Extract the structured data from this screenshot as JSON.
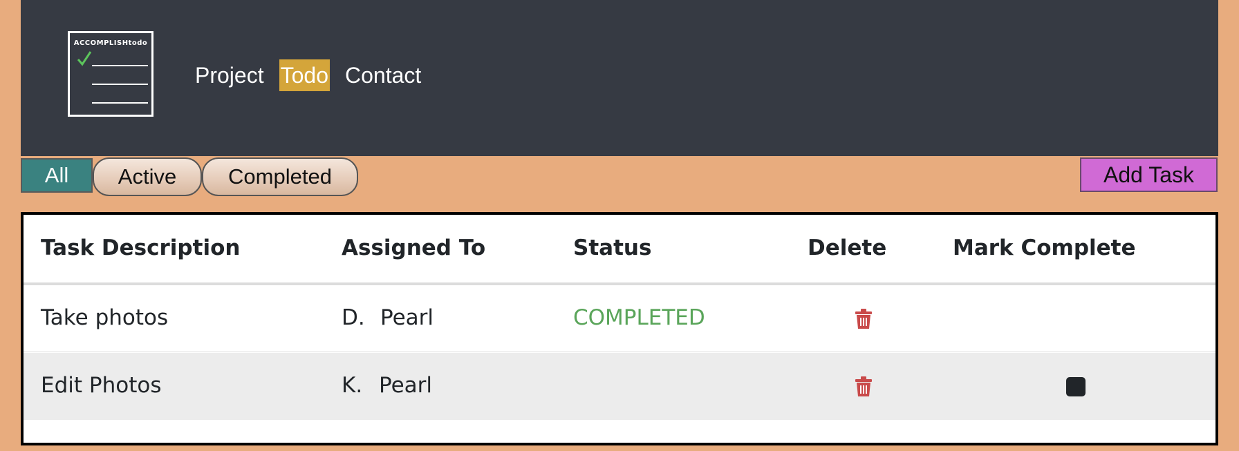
{
  "header": {
    "logo_text": "ACCOMPLISHtodo",
    "nav": [
      {
        "label": "Project",
        "active": false
      },
      {
        "label": "Todo",
        "active": true
      },
      {
        "label": "Contact",
        "active": false
      }
    ]
  },
  "filters": {
    "all": "All",
    "active": "Active",
    "completed": "Completed"
  },
  "add_task_label": "Add Task",
  "table": {
    "columns": [
      "Task Description",
      "Assigned To",
      "Status",
      "Delete",
      "Mark Complete"
    ],
    "rows": [
      {
        "description": "Take photos",
        "initial": "D.",
        "name": "Pearl",
        "status": "COMPLETED",
        "show_checkbox": false
      },
      {
        "description": "Edit Photos",
        "initial": "K.",
        "name": "Pearl",
        "status": "",
        "show_checkbox": true
      }
    ]
  },
  "icons": {
    "delete": "trash-icon",
    "logo_check": "checkmark-icon"
  },
  "colors": {
    "page_bg": "#e8ac7e",
    "header_bg": "#363a43",
    "nav_active_bg": "#d4a53a",
    "filter_all_bg": "#3a8280",
    "add_task_bg": "#d06ad5",
    "status_completed": "#5aa55a",
    "trash": "#c94a4a"
  }
}
